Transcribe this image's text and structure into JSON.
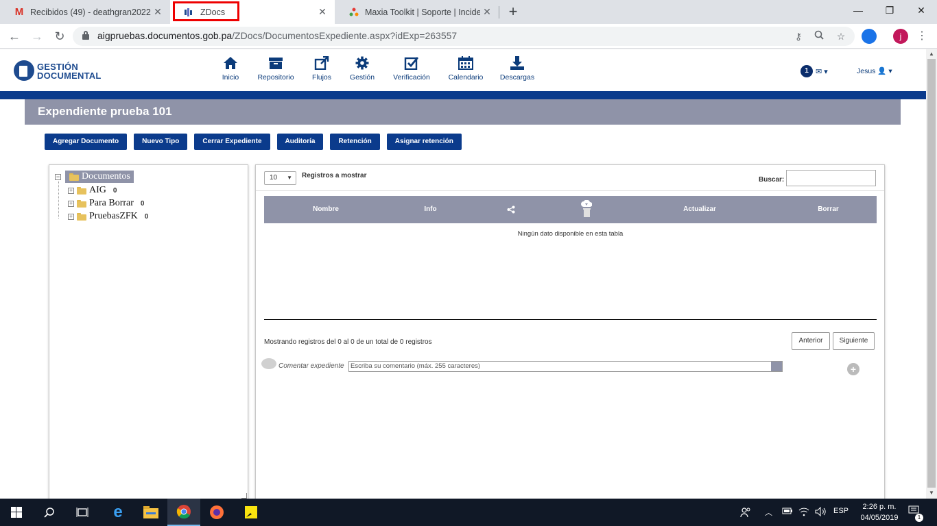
{
  "browser": {
    "tabs": [
      {
        "title": "Recibidos (49) - deathgran2022@",
        "icon": "gmail-icon"
      },
      {
        "title": "ZDocs",
        "icon": "zdocs-icon"
      },
      {
        "title": "Maxia Toolkit | Soporte | Incident",
        "icon": "maxia-icon"
      }
    ],
    "url_host": "aigpruebas.documentos.gob.pa",
    "url_path": "/ZDocs/DocumentosExpediente.aspx?idExp=263557",
    "profile_initial": "j"
  },
  "header": {
    "logo_line1": "GESTIÓN",
    "logo_line2": "DOCUMENTAL",
    "nav": [
      {
        "label": "Inicio",
        "icon": "home-icon"
      },
      {
        "label": "Repositorio",
        "icon": "archive-icon"
      },
      {
        "label": "Flujos",
        "icon": "external-link-icon"
      },
      {
        "label": "Gestión",
        "icon": "gear-icon"
      },
      {
        "label": "Verificación",
        "icon": "checkbox-icon"
      },
      {
        "label": "Calendario",
        "icon": "calendar-icon"
      },
      {
        "label": "Descargas",
        "icon": "download-icon"
      }
    ],
    "notifications_count": "1",
    "user_name": "Jesus"
  },
  "page_title": "Expendiente prueba 101",
  "actions": [
    "Agregar Documento",
    "Nuevo Tipo",
    "Cerrar Expediente",
    "Auditoría",
    "Retención",
    "Asignar retención"
  ],
  "tree": {
    "root": "Documentos",
    "children": [
      {
        "label": "AIG",
        "count": "0"
      },
      {
        "label": "Para Borrar",
        "count": "0"
      },
      {
        "label": "PruebasZFK",
        "count": "0"
      }
    ]
  },
  "table": {
    "page_length": "10",
    "length_label": "Registros a mostrar",
    "search_label": "Buscar:",
    "columns": [
      "Nombre",
      "Info",
      "",
      "",
      "Actualizar",
      "Borrar"
    ],
    "empty_message": "Ningún dato disponible en esta tabla",
    "info": "Mostrando registros del 0 al 0 de un total de 0 registros",
    "prev": "Anterior",
    "next": "Siguiente"
  },
  "comment": {
    "label": "Comentar expediente",
    "placeholder": "Escriba su comentario (máx. 255 caracteres)"
  },
  "taskbar": {
    "language": "ESP",
    "time": "2:26 p. m.",
    "date": "04/05/2019",
    "notification_count": "1"
  },
  "colors": {
    "brand_blue": "#0b3b8c",
    "header_gray": "#8f93a8",
    "highlight": "#ee0000"
  }
}
